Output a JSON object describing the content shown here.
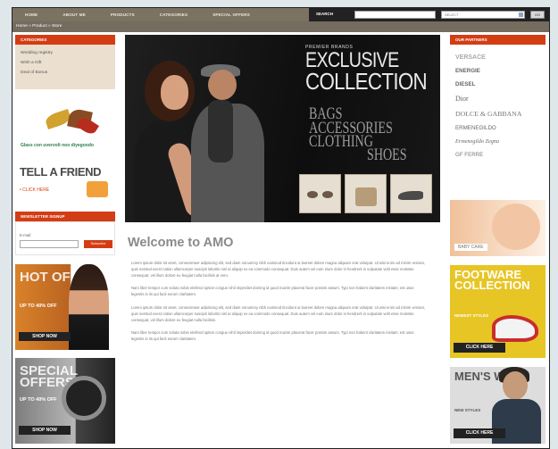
{
  "topnav": [
    "HOME",
    "ABOUT ME",
    "PRODUCTS",
    "CATEGORIES",
    "SPECIAL OFFERS"
  ],
  "search": {
    "label": "SEARCH",
    "select_value": "SELECT",
    "button": "GO"
  },
  "breadcrumb": "Home » Product » Store",
  "categories": {
    "title": "CATEGORIES",
    "items": [
      "Wedding registry",
      "Wish a Gift",
      "Deal of Bonus"
    ]
  },
  "promo": {
    "leaves_text": "Glass con uvervolt noo diyegoodo"
  },
  "tell_friend": {
    "title": "TELL A FRIEND",
    "subtitle": "• CLICK HERE"
  },
  "newsletter": {
    "title": "NEWSLETTER SIGNUP",
    "label": "E-mail:",
    "button": "Subscribe"
  },
  "offers": [
    {
      "title": "HOT OFFERS",
      "line": "UP TO 40% OFF",
      "button": "SHOP NOW"
    },
    {
      "title": "SPECIAL OFFERS",
      "line": "UP TO 40% OFF",
      "button": "SHOP NOW"
    }
  ],
  "hero": {
    "top_text": "PREMIER BRANDS",
    "title_line1": "EXCLUSIVE",
    "title_line2": "COLLECTION",
    "sub_lines": [
      "BAGS",
      "ACCESSORIES",
      "CLOTHING",
      "SHOES"
    ]
  },
  "content": {
    "welcome": "Welcome to AMO",
    "paragraphs": [
      "Lorem ipsum dolor sit amet, consectetuer adipiscing elit, sed diam nonummy nibh euismod tincidunt ut laoreet dolore magna aliquam erat volutpat. Ut wisi enim ad minim veniam, quis nostrud exerci tation ullamcorper suscipit lobortis nisl ut aliquip ex ea commodo consequat. Duis autem vel eum iriure dolor in hendrerit in vulputate velit esse molestie consequat, vel illum dolore eu feugiat nulla facilisis at vero.",
      "Nam liber tempor cum soluta nobis eleifend option congue nihil imperdiet doming id quod mazim placerat facer possim assum. Typi non habent claritatem insitam; est usus legentis in iis qui facit eorum claritatem.",
      "Lorem ipsum dolor sit amet, consectetuer adipiscing elit, sed diam nonummy nibh euismod tincidunt ut laoreet dolore magna aliquam erat volutpat. Ut wisi enim ad minim veniam, quis nostrud exerci tation ullamcorper suscipit lobortis nisl ut aliquip ex ea commodo consequat. Duis autem vel eum iriure dolor in hendrerit in vulputate velit esse molestie consequat, vel illum dolore eu feugiat nulla facilisis.",
      "Nam liber tempor cum soluta nobis eleifend option congue nihil imperdiet doming id quod mazim placerat facer possim assum. Typi non habent claritatem insitam; est usus legentis in iis qui facit eorum claritatem."
    ]
  },
  "brands": {
    "title": "OUR PARTNERS",
    "items": [
      "VERSACE",
      "ENERGIE",
      "DIESEL",
      "Dior",
      "DOLCE & GABBANA",
      "ERMENEGILDO",
      "Ermenegildo Zegna",
      "GF FERRE"
    ]
  },
  "ads": {
    "baby": "BABY CARE",
    "footwear": {
      "title": "FOOTWARE COLLECTION",
      "line": "NEWEST STYLES",
      "button": "CLICK HERE"
    },
    "mens": {
      "title": "MEN'S WEAR",
      "line": "NEW STYLES",
      "button": "CLICK HERE"
    }
  }
}
